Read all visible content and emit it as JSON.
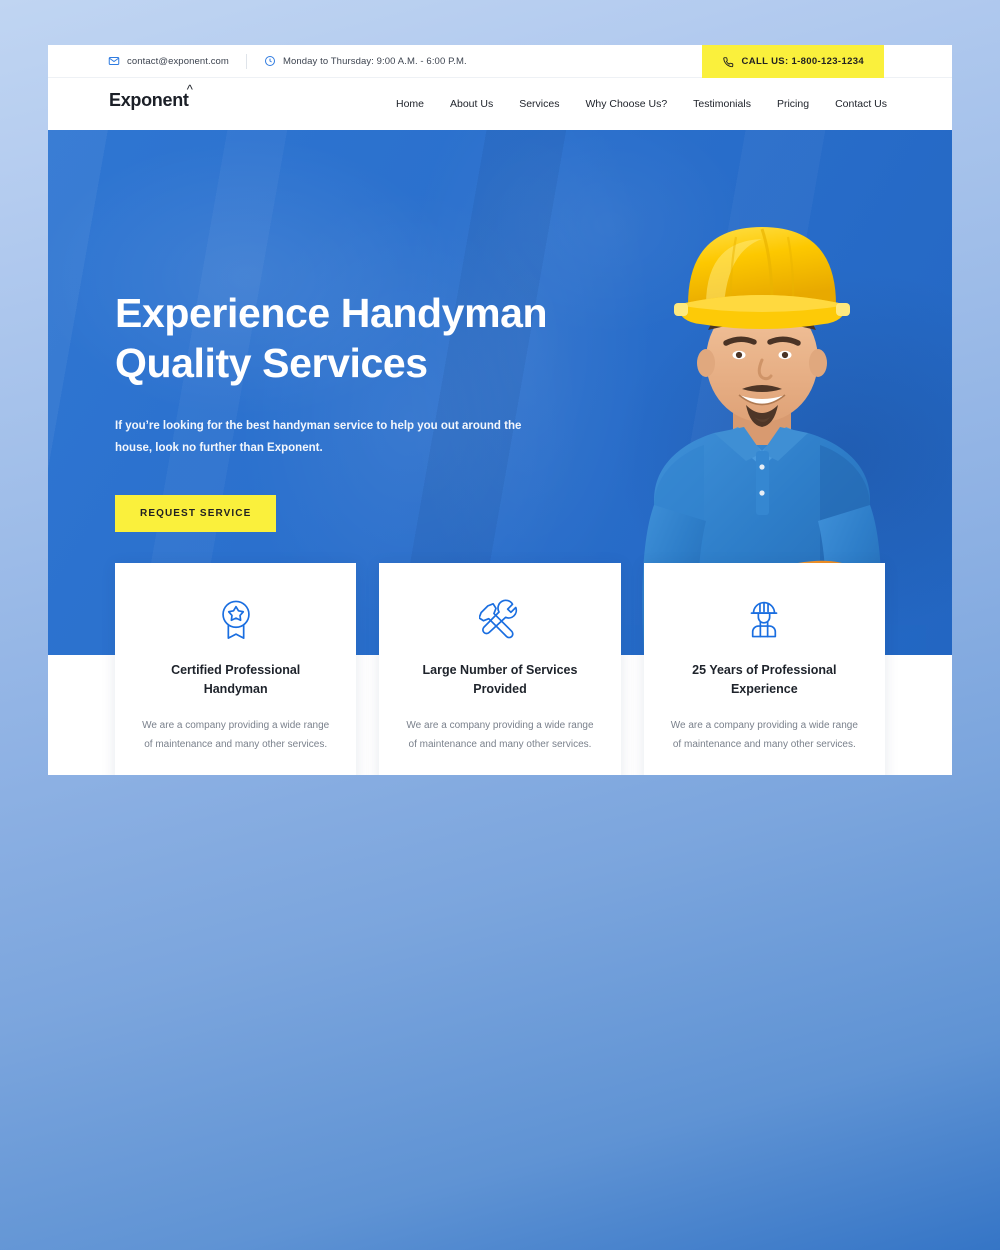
{
  "topbar": {
    "email": "contact@exponent.com",
    "email_icon": "envelope-icon",
    "hours": "Monday to Thursday: 9:00 A.M. - 6:00 P.M.",
    "hours_icon": "clock-icon",
    "call_label": "CALL US: 1-800-123-1234",
    "call_icon": "phone-icon",
    "call_bg": "#faf03c"
  },
  "brand": {
    "name": "Exponent",
    "accent": "^"
  },
  "nav": {
    "items": [
      {
        "label": "Home"
      },
      {
        "label": "About Us"
      },
      {
        "label": "Services"
      },
      {
        "label": "Why Choose Us?"
      },
      {
        "label": "Testimonials"
      },
      {
        "label": "Pricing"
      },
      {
        "label": "Contact Us"
      }
    ]
  },
  "hero": {
    "title_line1": "Experience Handyman",
    "title_line2": "Quality Services",
    "subtitle": "If you’re looking for the best handyman service to help you out around the house, look no further than Exponent.",
    "cta_label": "REQUEST SERVICE",
    "bg_color": "#2a6fcc",
    "photo_alt": "handyman-with-yellow-hardhat"
  },
  "cards": [
    {
      "icon": "award-badge-icon",
      "title": "Certified Professional Handyman",
      "text": "We are a company providing a wide range of maintenance and many other services."
    },
    {
      "icon": "wrench-screwdriver-icon",
      "title": "Large Number of Services Provided",
      "text": "We are a company providing a wide range of maintenance and many other services."
    },
    {
      "icon": "worker-hardhat-icon",
      "title": "25 Years of Professional Experience",
      "text": "We are a company providing a wide range of maintenance and many other services."
    }
  ],
  "theme": {
    "accent_blue": "#2a6fcc",
    "icon_blue": "#1a6ee0",
    "yellow": "#faf03c"
  }
}
